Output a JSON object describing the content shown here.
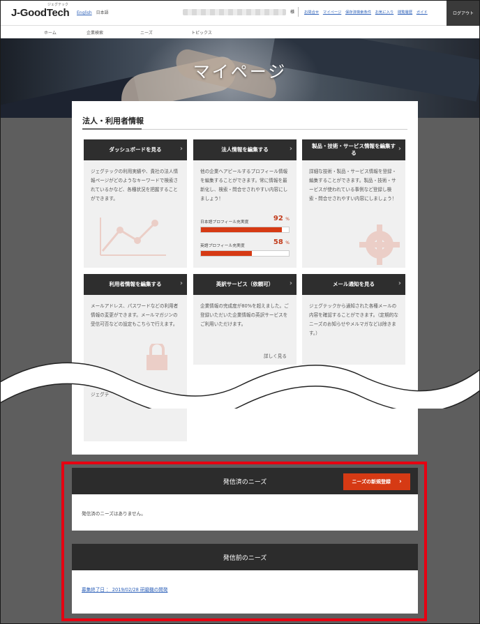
{
  "header": {
    "logo": "J-GoodTech",
    "logo_ruby": "ジェグテック",
    "lang_en": "English",
    "lang_ja": "日本語",
    "honorific": "様",
    "links": [
      "お問合せ",
      "マイページ",
      "保存済検索条件",
      "お気に入り",
      "閲覧履歴",
      "ガイド"
    ],
    "logout": "ログアウト"
  },
  "subnav": [
    "ホーム",
    "企業検索",
    "ニーズ",
    "トピックス"
  ],
  "hero": {
    "title": "マイページ"
  },
  "section": {
    "title": "法人・利用者情報"
  },
  "cards": [
    {
      "title": "ダッシュボードを見る",
      "body": "ジェグテックの利用実績や、貴社の法人情報ページがどのようなキーワードで検索されているかなど、各種状況を把握することができます。"
    },
    {
      "title": "法人情報を編集する",
      "body": "他の企業へアピールするプロフィール情報を編集することができます。常に情報を最新化し、検索・問合せされやすい内容にしましょう！",
      "bars": [
        {
          "label": "日本語プロフィール充実度",
          "value": 92,
          "unit": "%"
        },
        {
          "label": "英語プロフィール充実度",
          "value": 58,
          "unit": "%"
        }
      ]
    },
    {
      "title": "製品・技術・サービス情報を編集する",
      "body": "詳細な技術・製品・サービス情報を登録・編集することができます。製品・技術・サービスが使われている事例など登録し検索・問合せされやすい内容にしましょう！"
    },
    {
      "title": "利用者情報を編集する",
      "body": "メールアドレス、パスワードなどの利用者情報の変更ができます。メールマガジンの受信可否などの設定もこちらで行えます。"
    },
    {
      "title": "英訳サービス（依頼可）",
      "body": "企業情報の完成度が80%を超えました。ご登録いただいた企業情報の英訳サービスをご利用いただけます。",
      "more": "詳しく見る"
    },
    {
      "title": "メール通知を見る",
      "body": "ジェグテックから通知された各種メールの内容を確認することができます。（定期的なニーズのお知らせやメルマガなどは除きます。）"
    }
  ],
  "truncated_text": "ジェグテ",
  "needs_sent": {
    "title": "発信済のニーズ",
    "new_button": "ニーズの新規登録",
    "empty": "発信済のニーズはありません。"
  },
  "needs_draft": {
    "title": "発信前のニーズ",
    "item": "募集終了日 ： 2019/02/28 研磨機の開発"
  },
  "colors": {
    "accent": "#d63a14",
    "header_dark": "#2e2e2e",
    "highlight": "#e60012",
    "link": "#2b5fb8"
  }
}
